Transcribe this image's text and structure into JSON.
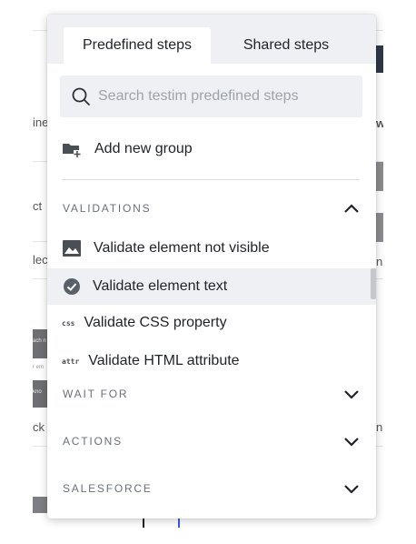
{
  "tabs": [
    {
      "label": "Predefined steps",
      "active": true
    },
    {
      "label": "Shared steps",
      "active": false
    }
  ],
  "search": {
    "placeholder": "Search testim predefined steps",
    "value": ""
  },
  "add_group": {
    "label": "Add new group",
    "icon": "folder-add-icon"
  },
  "sections": [
    {
      "label": "VALIDATIONS",
      "expanded": true,
      "chevron": "chevron-up-icon",
      "items": [
        {
          "label": "Validate element not visible",
          "icon": "image-icon",
          "selected": false
        },
        {
          "label": "Validate element text",
          "icon": "check-circle-icon",
          "selected": true
        },
        {
          "label": "Validate CSS property",
          "icon": "css",
          "selected": false
        },
        {
          "label": "Validate HTML attribute",
          "icon": "attr",
          "selected": false
        }
      ]
    },
    {
      "label": "WAIT FOR",
      "expanded": false,
      "chevron": "chevron-down-icon"
    },
    {
      "label": "ACTIONS",
      "expanded": false,
      "chevron": "chevron-down-icon"
    },
    {
      "label": "SALESFORCE",
      "expanded": false,
      "chevron": "chevron-down-icon"
    }
  ],
  "background": {
    "fragments": [
      "ine",
      "ct",
      "lec",
      "ck",
      "w",
      "na",
      "na"
    ],
    "thumbnail_texts": [
      "ach n",
      "r em",
      "kno"
    ]
  },
  "colors": {
    "tabbar_bg": "#eef0f3",
    "selected_bg": "#eef0f3",
    "section_text": "#6a7079",
    "icon_dark": "#4a4f56"
  }
}
